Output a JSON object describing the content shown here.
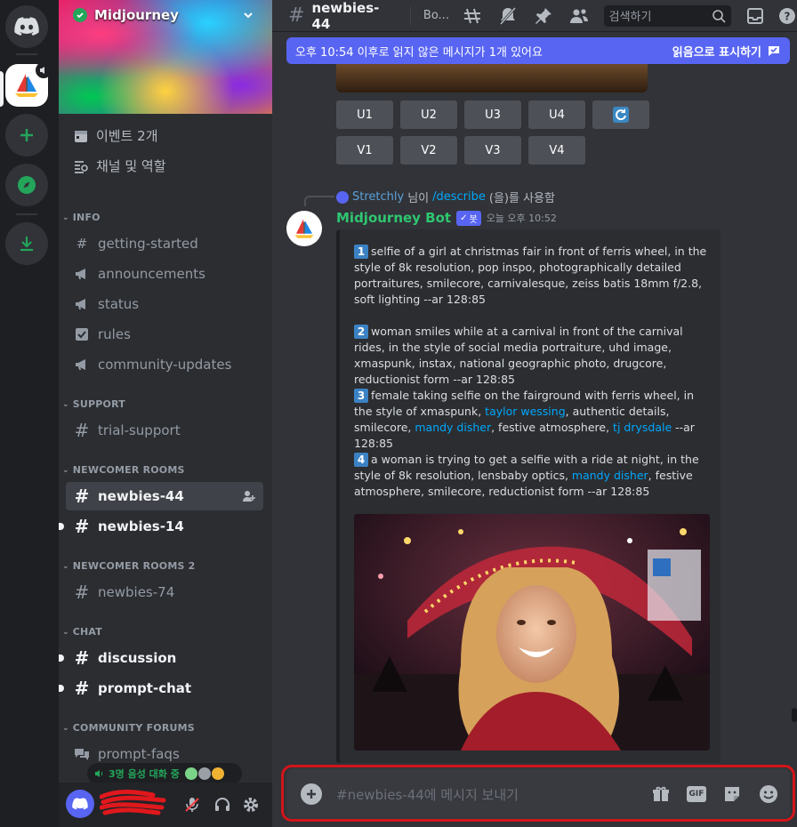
{
  "server_list": {
    "items": [
      "Discord Home",
      "Midjourney",
      "Add a Server",
      "Explore Discoverable Servers",
      "Download Apps"
    ]
  },
  "guild": {
    "name": "Midjourney",
    "menu": {
      "events": "이벤트 2개",
      "channels_roles": "채널 및 역할"
    }
  },
  "categories": [
    {
      "name": "INFO",
      "channels": [
        "getting-started",
        "announcements",
        "status",
        "rules",
        "community-updates"
      ]
    },
    {
      "name": "SUPPORT",
      "channels": [
        "trial-support"
      ]
    },
    {
      "name": "NEWCOMER ROOMS",
      "channels": [
        "newbies-44",
        "newbies-14"
      ]
    },
    {
      "name": "NEWCOMER ROOMS 2",
      "channels": [
        "newbies-74"
      ]
    },
    {
      "name": "CHAT",
      "channels": [
        "discussion",
        "prompt-chat"
      ]
    },
    {
      "name": "COMMUNITY FORUMS",
      "channels": [
        "prompt-faqs"
      ]
    }
  ],
  "voice_pill": "3명 음성 대화 중",
  "topbar": {
    "channel": "newbies-44",
    "topic": "Bo...",
    "search_placeholder": "검색하기"
  },
  "notice": {
    "text": "오후 10:54 이후로 읽지 않은 메시지가 1개 있어요",
    "action": "읽음으로 표시하기"
  },
  "upscale_buttons": [
    "U1",
    "U2",
    "U3",
    "U4"
  ],
  "variation_buttons": [
    "V1",
    "V2",
    "V3",
    "V4"
  ],
  "message": {
    "reply_user": "Stretchly",
    "reply_mid": " 님이 ",
    "reply_command": "/describe",
    "reply_end": "(을)를 사용함",
    "author": "Midjourney Bot",
    "bot_tag": "봇",
    "timestamp": "오늘 오후 10:52",
    "prompts": [
      {
        "num": "1",
        "parts": [
          {
            "t": "selfie of a girl at christmas fair in front of ferris wheel, in the style of 8k resolution, pop inspo, photographically detailed portraitures, smilecore, carnivalesque, zeiss batis 18mm f/2.8, soft lighting --ar 128:85"
          }
        ]
      },
      {
        "num": "2",
        "parts": [
          {
            "t": "woman smiles while at a carnival in front of the carnival rides, in the style of social media portraiture, uhd image, xmaspunk, instax, national geographic photo, drugcore, reductionist form --ar 128:85"
          }
        ]
      },
      {
        "num": "3",
        "parts": [
          {
            "t": "female taking selfie on the fairground with ferris wheel, in the style of xmaspunk, "
          },
          {
            "t": "taylor wessing",
            "link": true
          },
          {
            "t": ", authentic details, smilecore, "
          },
          {
            "t": "mandy disher",
            "link": true
          },
          {
            "t": ", festive atmosphere, "
          },
          {
            "t": "tj drysdale",
            "link": true
          },
          {
            "t": " --ar 128:85"
          }
        ]
      },
      {
        "num": "4",
        "parts": [
          {
            "t": "a woman is trying to get a selfie with a ride at night, in the style of 8k resolution, lensbaby optics, "
          },
          {
            "t": "mandy disher",
            "link": true
          },
          {
            "t": ", festive atmosphere, smilecore, reductionist form --ar 128:85"
          }
        ]
      }
    ]
  },
  "composer": {
    "placeholder": "#newbies-44에 메시지 보내기",
    "gif_label": "GIF"
  },
  "colors": {
    "accent": "#5865f2",
    "online": "#23a55a",
    "link": "#00a8fc",
    "highlight_outline": "#d2151a"
  }
}
